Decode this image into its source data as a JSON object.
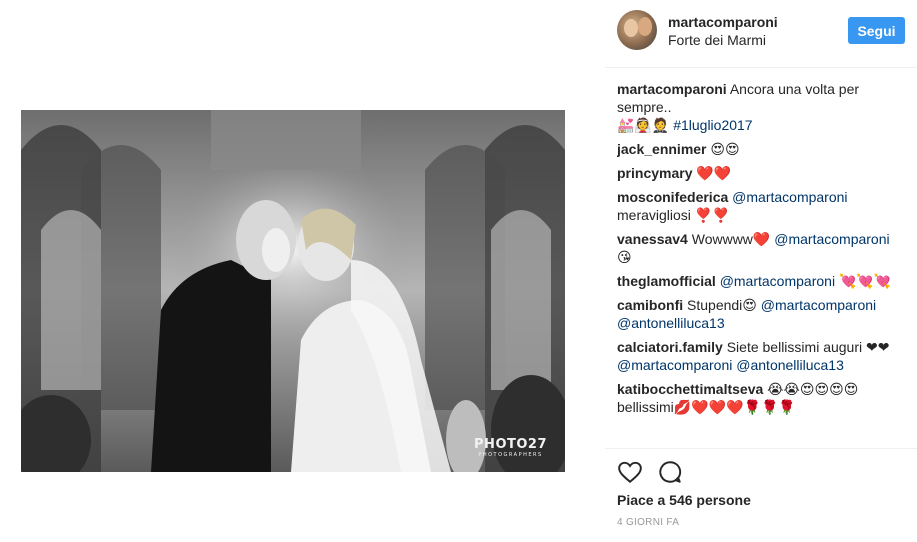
{
  "post": {
    "photo_alt": "wedding kiss",
    "watermark_main": "PHOTO27",
    "watermark_sub": "PHOTOGRAPHERS"
  },
  "header": {
    "username": "martacomparoni",
    "location": "Forte dei Marmi",
    "follow_label": "Segui"
  },
  "comments": [
    {
      "user": "martacomparoni",
      "parts": [
        {
          "t": "text",
          "v": " Ancora una volta per sempre.."
        },
        {
          "t": "br"
        },
        {
          "t": "text",
          "v": "💒👰🤵 "
        },
        {
          "t": "hashtag",
          "v": "#1luglio2017"
        }
      ]
    },
    {
      "user": "jack_ennimer",
      "parts": [
        {
          "t": "text",
          "v": " 😍😍"
        }
      ]
    },
    {
      "user": "princymary",
      "parts": [
        {
          "t": "text",
          "v": " ❤️❤️"
        }
      ]
    },
    {
      "user": "mosconifederica",
      "parts": [
        {
          "t": "text",
          "v": " "
        },
        {
          "t": "mention",
          "v": "@martacomparoni"
        },
        {
          "t": "text",
          "v": " meravigliosi ❣️❣️"
        }
      ]
    },
    {
      "user": "vanessav4",
      "parts": [
        {
          "t": "text",
          "v": " Wowwww❤️ "
        },
        {
          "t": "mention",
          "v": "@martacomparoni"
        },
        {
          "t": "text",
          "v": " 😘"
        }
      ]
    },
    {
      "user": "theglamofficial",
      "parts": [
        {
          "t": "text",
          "v": " "
        },
        {
          "t": "mention",
          "v": "@martacomparoni"
        },
        {
          "t": "text",
          "v": " 💘💘💘"
        }
      ]
    },
    {
      "user": "camibonfi",
      "parts": [
        {
          "t": "text",
          "v": " Stupendi😍 "
        },
        {
          "t": "mention",
          "v": "@martacomparoni"
        },
        {
          "t": "text",
          "v": " "
        },
        {
          "t": "mention",
          "v": "@antonelliluca13"
        }
      ]
    },
    {
      "user": "calciatori.family",
      "parts": [
        {
          "t": "text",
          "v": " Siete bellissimi auguri ❤❤ "
        },
        {
          "t": "mention",
          "v": "@martacomparoni"
        },
        {
          "t": "text",
          "v": " "
        },
        {
          "t": "mention",
          "v": "@antonelliluca13"
        }
      ]
    },
    {
      "user": "katibocchettimaltseva",
      "parts": [
        {
          "t": "text",
          "v": " 😭😭😍😍😍😍 bellissimi💋❤️❤️❤️🌹🌹🌹"
        }
      ]
    }
  ],
  "footer": {
    "likes_text": "Piace a 546 persone",
    "time_text": "4 GIORNI FA"
  },
  "colors": {
    "accent": "#3897f0",
    "mention": "#003569",
    "time": "#999999"
  },
  "icons": {
    "like": "heart-icon",
    "comment": "comment-icon"
  }
}
